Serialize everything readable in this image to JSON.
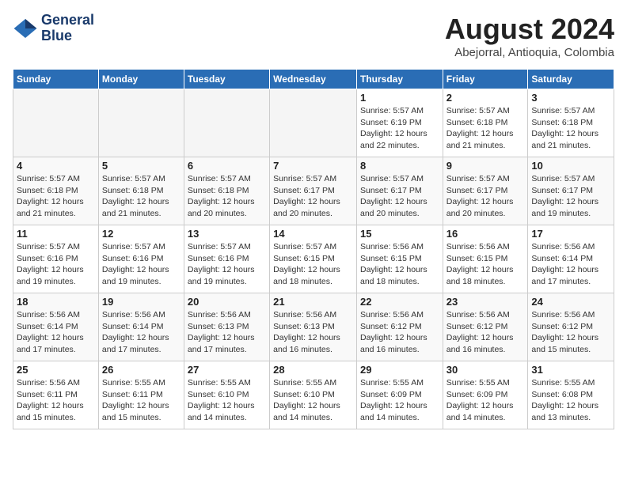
{
  "header": {
    "logo_line1": "General",
    "logo_line2": "Blue",
    "month_year": "August 2024",
    "location": "Abejorral, Antioquia, Colombia"
  },
  "weekdays": [
    "Sunday",
    "Monday",
    "Tuesday",
    "Wednesday",
    "Thursday",
    "Friday",
    "Saturday"
  ],
  "weeks": [
    [
      {
        "day": "",
        "info": ""
      },
      {
        "day": "",
        "info": ""
      },
      {
        "day": "",
        "info": ""
      },
      {
        "day": "",
        "info": ""
      },
      {
        "day": "1",
        "info": "Sunrise: 5:57 AM\nSunset: 6:19 PM\nDaylight: 12 hours\nand 22 minutes."
      },
      {
        "day": "2",
        "info": "Sunrise: 5:57 AM\nSunset: 6:18 PM\nDaylight: 12 hours\nand 21 minutes."
      },
      {
        "day": "3",
        "info": "Sunrise: 5:57 AM\nSunset: 6:18 PM\nDaylight: 12 hours\nand 21 minutes."
      }
    ],
    [
      {
        "day": "4",
        "info": "Sunrise: 5:57 AM\nSunset: 6:18 PM\nDaylight: 12 hours\nand 21 minutes."
      },
      {
        "day": "5",
        "info": "Sunrise: 5:57 AM\nSunset: 6:18 PM\nDaylight: 12 hours\nand 21 minutes."
      },
      {
        "day": "6",
        "info": "Sunrise: 5:57 AM\nSunset: 6:18 PM\nDaylight: 12 hours\nand 20 minutes."
      },
      {
        "day": "7",
        "info": "Sunrise: 5:57 AM\nSunset: 6:17 PM\nDaylight: 12 hours\nand 20 minutes."
      },
      {
        "day": "8",
        "info": "Sunrise: 5:57 AM\nSunset: 6:17 PM\nDaylight: 12 hours\nand 20 minutes."
      },
      {
        "day": "9",
        "info": "Sunrise: 5:57 AM\nSunset: 6:17 PM\nDaylight: 12 hours\nand 20 minutes."
      },
      {
        "day": "10",
        "info": "Sunrise: 5:57 AM\nSunset: 6:17 PM\nDaylight: 12 hours\nand 19 minutes."
      }
    ],
    [
      {
        "day": "11",
        "info": "Sunrise: 5:57 AM\nSunset: 6:16 PM\nDaylight: 12 hours\nand 19 minutes."
      },
      {
        "day": "12",
        "info": "Sunrise: 5:57 AM\nSunset: 6:16 PM\nDaylight: 12 hours\nand 19 minutes."
      },
      {
        "day": "13",
        "info": "Sunrise: 5:57 AM\nSunset: 6:16 PM\nDaylight: 12 hours\nand 19 minutes."
      },
      {
        "day": "14",
        "info": "Sunrise: 5:57 AM\nSunset: 6:15 PM\nDaylight: 12 hours\nand 18 minutes."
      },
      {
        "day": "15",
        "info": "Sunrise: 5:56 AM\nSunset: 6:15 PM\nDaylight: 12 hours\nand 18 minutes."
      },
      {
        "day": "16",
        "info": "Sunrise: 5:56 AM\nSunset: 6:15 PM\nDaylight: 12 hours\nand 18 minutes."
      },
      {
        "day": "17",
        "info": "Sunrise: 5:56 AM\nSunset: 6:14 PM\nDaylight: 12 hours\nand 17 minutes."
      }
    ],
    [
      {
        "day": "18",
        "info": "Sunrise: 5:56 AM\nSunset: 6:14 PM\nDaylight: 12 hours\nand 17 minutes."
      },
      {
        "day": "19",
        "info": "Sunrise: 5:56 AM\nSunset: 6:14 PM\nDaylight: 12 hours\nand 17 minutes."
      },
      {
        "day": "20",
        "info": "Sunrise: 5:56 AM\nSunset: 6:13 PM\nDaylight: 12 hours\nand 17 minutes."
      },
      {
        "day": "21",
        "info": "Sunrise: 5:56 AM\nSunset: 6:13 PM\nDaylight: 12 hours\nand 16 minutes."
      },
      {
        "day": "22",
        "info": "Sunrise: 5:56 AM\nSunset: 6:12 PM\nDaylight: 12 hours\nand 16 minutes."
      },
      {
        "day": "23",
        "info": "Sunrise: 5:56 AM\nSunset: 6:12 PM\nDaylight: 12 hours\nand 16 minutes."
      },
      {
        "day": "24",
        "info": "Sunrise: 5:56 AM\nSunset: 6:12 PM\nDaylight: 12 hours\nand 15 minutes."
      }
    ],
    [
      {
        "day": "25",
        "info": "Sunrise: 5:56 AM\nSunset: 6:11 PM\nDaylight: 12 hours\nand 15 minutes."
      },
      {
        "day": "26",
        "info": "Sunrise: 5:55 AM\nSunset: 6:11 PM\nDaylight: 12 hours\nand 15 minutes."
      },
      {
        "day": "27",
        "info": "Sunrise: 5:55 AM\nSunset: 6:10 PM\nDaylight: 12 hours\nand 14 minutes."
      },
      {
        "day": "28",
        "info": "Sunrise: 5:55 AM\nSunset: 6:10 PM\nDaylight: 12 hours\nand 14 minutes."
      },
      {
        "day": "29",
        "info": "Sunrise: 5:55 AM\nSunset: 6:09 PM\nDaylight: 12 hours\nand 14 minutes."
      },
      {
        "day": "30",
        "info": "Sunrise: 5:55 AM\nSunset: 6:09 PM\nDaylight: 12 hours\nand 14 minutes."
      },
      {
        "day": "31",
        "info": "Sunrise: 5:55 AM\nSunset: 6:08 PM\nDaylight: 12 hours\nand 13 minutes."
      }
    ]
  ]
}
